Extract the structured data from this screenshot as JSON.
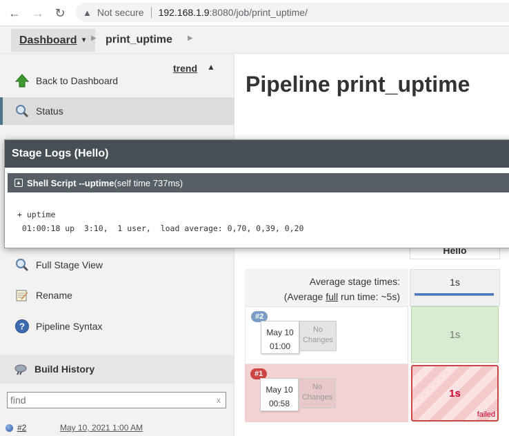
{
  "browser": {
    "not_secure": "Not secure",
    "url_host": "192.168.1.9",
    "url_path": ":8080/job/print_uptime/"
  },
  "breadcrumb": {
    "dashboard": "Dashboard",
    "job": "print_uptime"
  },
  "sidebar": {
    "items": [
      {
        "label": "Back to Dashboard",
        "icon": "up-arrow-icon"
      },
      {
        "label": "Status",
        "icon": "search-icon"
      },
      {
        "label": "Full Stage View",
        "icon": "search-icon"
      },
      {
        "label": "Rename",
        "icon": "notepad-icon"
      },
      {
        "label": "Pipeline Syntax",
        "icon": "help-icon"
      }
    ],
    "build_history": {
      "title": "Build History",
      "trend": "trend",
      "find_placeholder": "find",
      "clear": "x",
      "builds": [
        {
          "number": "#2",
          "date": "May 10, 2021 1:00 AM"
        }
      ]
    }
  },
  "main": {
    "title": "Pipeline print_uptime",
    "stage_name": "Hello",
    "avg_label": "Average stage times:",
    "avg_full_prefix": "(Average ",
    "avg_full_word": "full",
    "avg_full_suffix": " run time: ~5s)",
    "avg_time": "1s",
    "runs": [
      {
        "badge": "#2",
        "month_day": "May 10",
        "time": "01:00",
        "changes1": "No",
        "changes2": "Changes",
        "duration": "1s",
        "status": "success"
      },
      {
        "badge": "#1",
        "month_day": "May 10",
        "time": "00:58",
        "changes1": "No",
        "changes2": "Changes",
        "duration": "1s",
        "status": "failed",
        "status_label": "failed"
      }
    ]
  },
  "modal": {
    "title": "Stage Logs (Hello)",
    "step_prefix": "Shell Script -- ",
    "step_name": "uptime",
    "step_suffix": " (self time 737ms)",
    "log_lines": [
      "+ uptime",
      " 01:00:18 up  3:10,  1 user,  load average: 0,70, 0,39, 0,20"
    ]
  },
  "colors": {
    "modal_header": "#474e55",
    "success_cell": "#d7ecd0",
    "failed_border": "#cc4444"
  }
}
